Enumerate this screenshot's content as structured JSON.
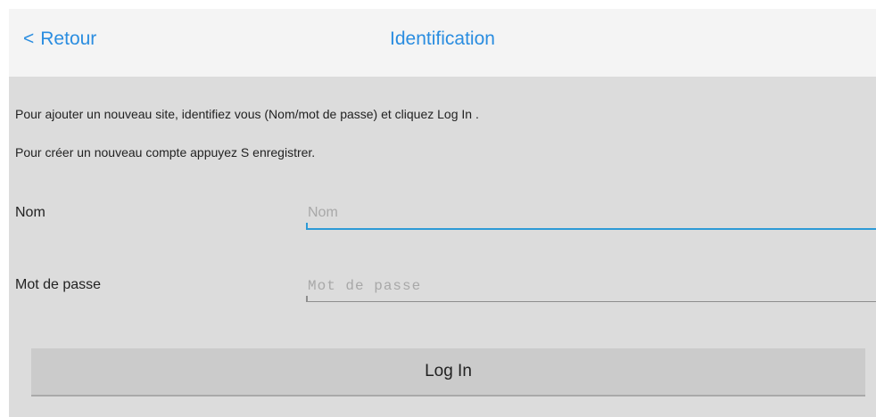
{
  "header": {
    "back_chevron": "<",
    "back_label": "Retour",
    "title": "Identification"
  },
  "instructions": {
    "line1": "Pour ajouter un nouveau site, identifiez vous (Nom/mot de passe) et cliquez Log In .",
    "line2": "Pour créer un nouveau compte appuyez S enregistrer."
  },
  "form": {
    "name_label": "Nom",
    "name_placeholder": "Nom",
    "name_value": "",
    "password_label": "Mot de passe",
    "password_placeholder": "Mot de passe",
    "password_value": "",
    "login_label": "Log In"
  },
  "colors": {
    "accent": "#2a8de0",
    "focus_underline": "#2d9ad6",
    "background": "#dcdcdc",
    "header_background": "#f4f4f4",
    "button_background": "#cbcbcb"
  }
}
